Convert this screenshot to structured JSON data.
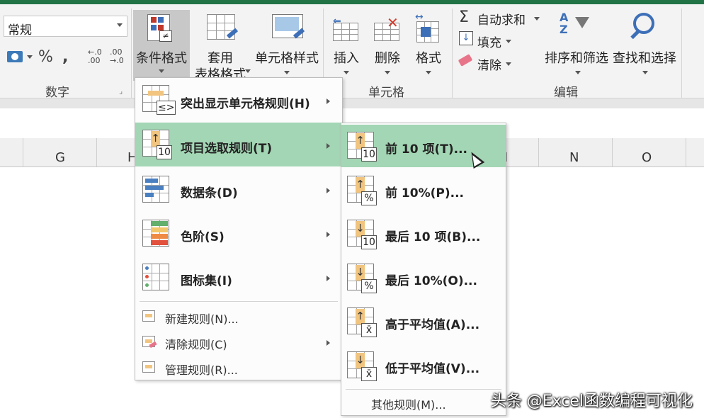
{
  "ribbon": {
    "number_format": {
      "value": "常规"
    },
    "number_buttons": {
      "percent": "%",
      "comma": "❜",
      "inc_decimal": "←.0\n.00",
      "dec_decimal": ".00\n→.0"
    },
    "groups": {
      "number": "数字",
      "cells": "单元格",
      "editing": "编辑"
    },
    "buttons": {
      "conditional_format": "条件格式",
      "table_format_line1": "套用",
      "table_format_line2": "表格格式",
      "cell_styles": "单元格样式",
      "insert": "插入",
      "delete": "删除",
      "format": "格式",
      "autosum": "自动求和",
      "fill": "填充",
      "clear": "清除",
      "sort_filter": "排序和筛选",
      "find_select": "查找和选择"
    }
  },
  "columns": {
    "g": "G",
    "h": "H",
    "m_partial": "I",
    "n": "N",
    "o": "O"
  },
  "main_menu": {
    "items": [
      {
        "label": "突出显示单元格规则(H)",
        "badge": "≤>"
      },
      {
        "label": "项目选取规则(T)",
        "badge": "10"
      },
      {
        "label": "数据条(D)"
      },
      {
        "label": "色阶(S)"
      },
      {
        "label": "图标集(I)"
      }
    ],
    "small_items": [
      {
        "label": "新建规则(N)..."
      },
      {
        "label": "清除规则(C)"
      },
      {
        "label": "管理规则(R)..."
      }
    ]
  },
  "sub_menu": {
    "items": [
      {
        "label": "前 10 项(T)...",
        "badge": "10",
        "arrow": "↑"
      },
      {
        "label": "前 10%(P)...",
        "badge": "%",
        "arrow": "↑"
      },
      {
        "label": "最后 10 项(B)...",
        "badge": "10",
        "arrow": "↓"
      },
      {
        "label": "最后 10%(O)...",
        "badge": "%",
        "arrow": "↓"
      },
      {
        "label": "高于平均值(A)...",
        "badge": "x̄",
        "arrow": "↑"
      },
      {
        "label": "低于平均值(V)...",
        "badge": "x̄",
        "arrow": "↓"
      }
    ],
    "other": "其他规则(M)..."
  },
  "watermark": "头条 @Excel函数编程可视化",
  "colors": {
    "highlight": "#a3d6b4",
    "accent": "#217346",
    "icon_fill": "#f1c57f"
  }
}
